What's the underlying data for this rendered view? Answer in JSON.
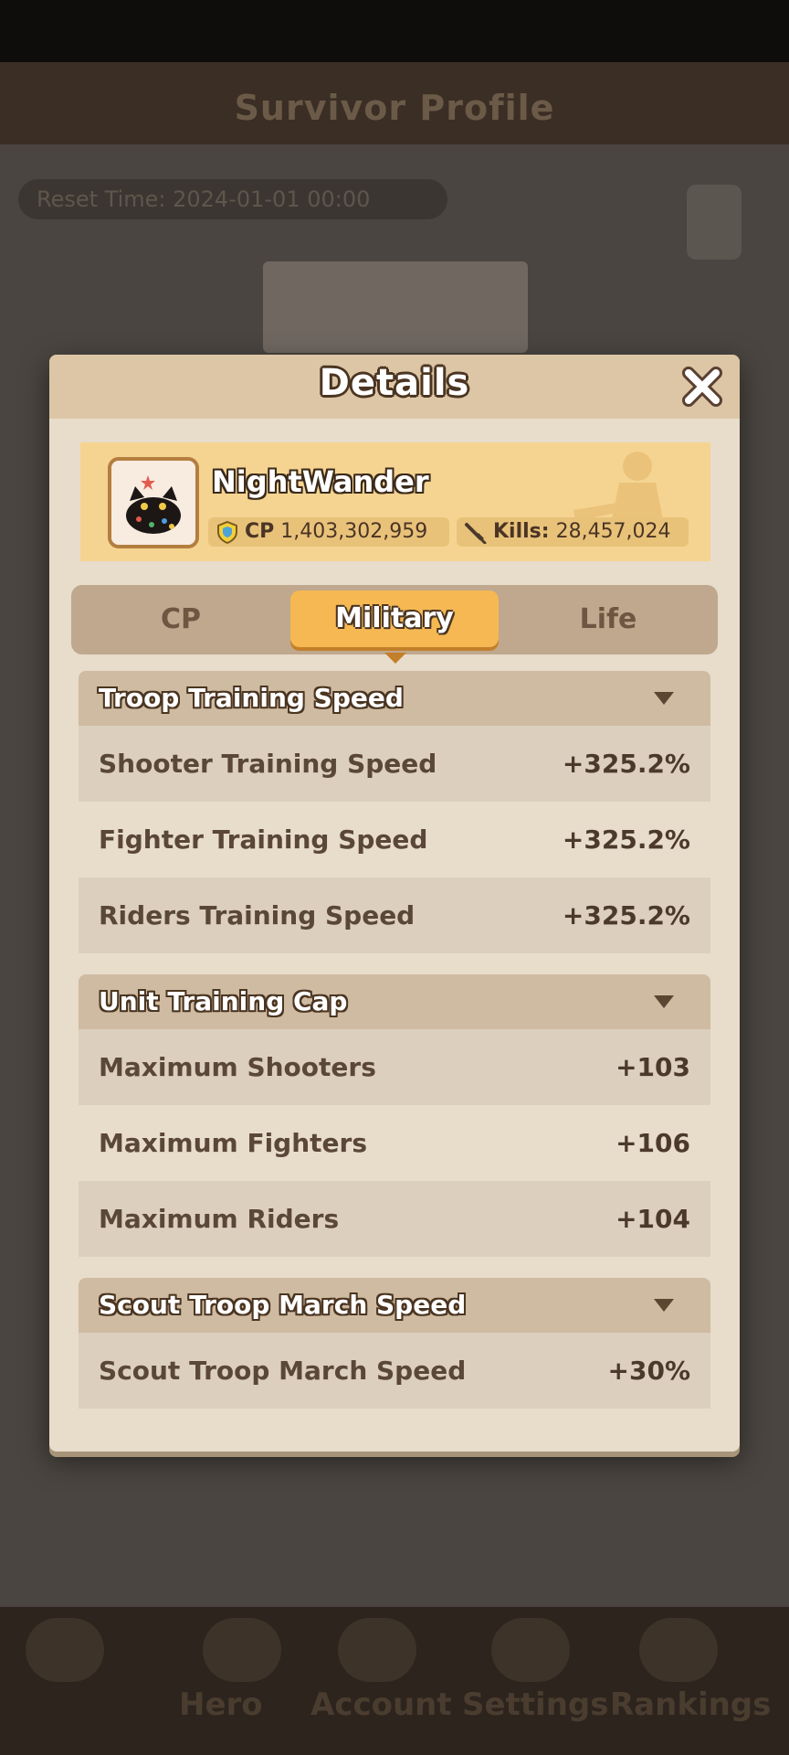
{
  "background": {
    "title": "Survivor Profile",
    "reset_time": "Reset Time: 2024-01-01 00:00",
    "nav": [
      "Hero",
      "Account",
      "Settings",
      "Rankings"
    ]
  },
  "dialog": {
    "title": "Details",
    "close_icon": "close-icon",
    "player": {
      "name": "NightWander",
      "cp_label": "CP",
      "cp_value": "1,403,302,959",
      "kills_label": "Kills:",
      "kills_value": "28,457,024"
    },
    "tabs": [
      {
        "label": "CP",
        "active": false
      },
      {
        "label": "Military",
        "active": true
      },
      {
        "label": "Life",
        "active": false
      }
    ],
    "sections": [
      {
        "title": "Troop Training Speed",
        "rows": [
          {
            "label": "Shooter Training Speed",
            "value": "+325.2%"
          },
          {
            "label": "Fighter Training Speed",
            "value": "+325.2%"
          },
          {
            "label": "Riders Training Speed",
            "value": "+325.2%"
          }
        ]
      },
      {
        "title": "Unit Training Cap",
        "rows": [
          {
            "label": "Maximum Shooters",
            "value": "+103"
          },
          {
            "label": "Maximum Fighters",
            "value": "+106"
          },
          {
            "label": "Maximum Riders",
            "value": "+104"
          }
        ]
      },
      {
        "title": "Scout Troop March Speed",
        "rows": [
          {
            "label": "Scout Troop March Speed",
            "value": "+30%"
          }
        ]
      }
    ]
  },
  "colors": {
    "accent": "#f5b853",
    "panel": "#e8dccb",
    "banner": "#f5d491",
    "text": "#5a4737"
  }
}
